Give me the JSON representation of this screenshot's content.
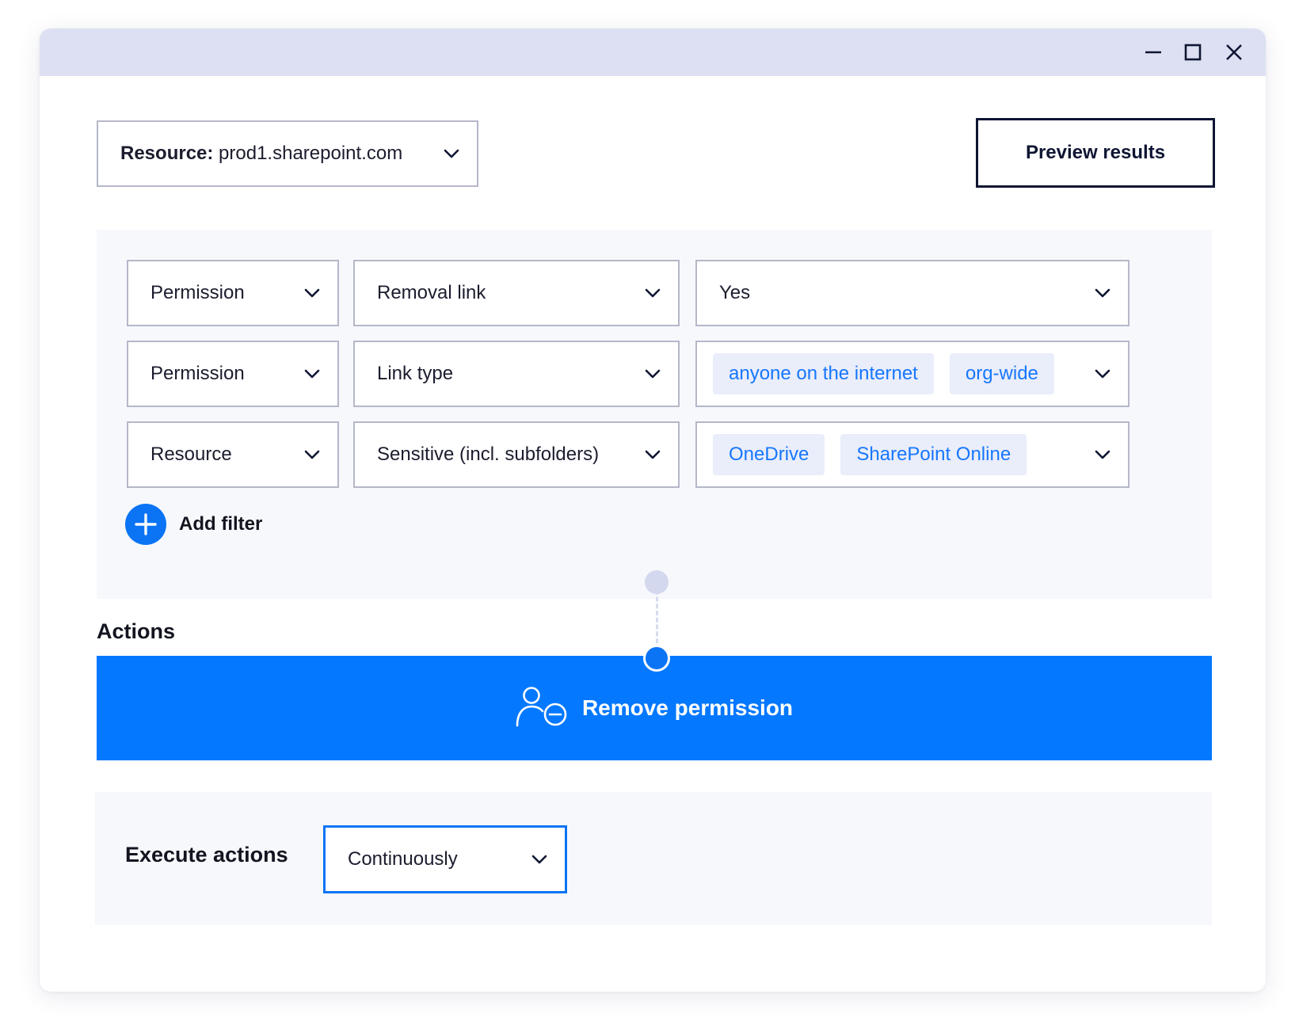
{
  "window_controls": {
    "minimize": "minimize-icon",
    "maximize": "maximize-icon",
    "close": "close-icon"
  },
  "resource_select": {
    "label": "Resource:",
    "value": "prod1.sharepoint.com"
  },
  "preview_button": "Preview results",
  "filters": [
    {
      "field": "Permission",
      "condition": "Removal link",
      "value": "Yes",
      "chips": []
    },
    {
      "field": "Permission",
      "condition": "Link type",
      "value": "",
      "chips": [
        "anyone on the internet",
        "org-wide"
      ]
    },
    {
      "field": "Resource",
      "condition": "Sensitive (incl. subfolders)",
      "value": "",
      "chips": [
        "OneDrive",
        "SharePoint Online"
      ]
    }
  ],
  "add_filter_label": "Add filter",
  "actions": {
    "title": "Actions",
    "action_label": "Remove permission",
    "action_icon": "user-remove-icon"
  },
  "execute": {
    "label": "Execute actions",
    "value": "Continuously"
  },
  "colors": {
    "accent": "#0478FF",
    "titlebar": "#DCE0F2",
    "chip_bg": "#EAEDFA",
    "panel_bg": "#F7F8FC",
    "dark": "#0F1633"
  }
}
